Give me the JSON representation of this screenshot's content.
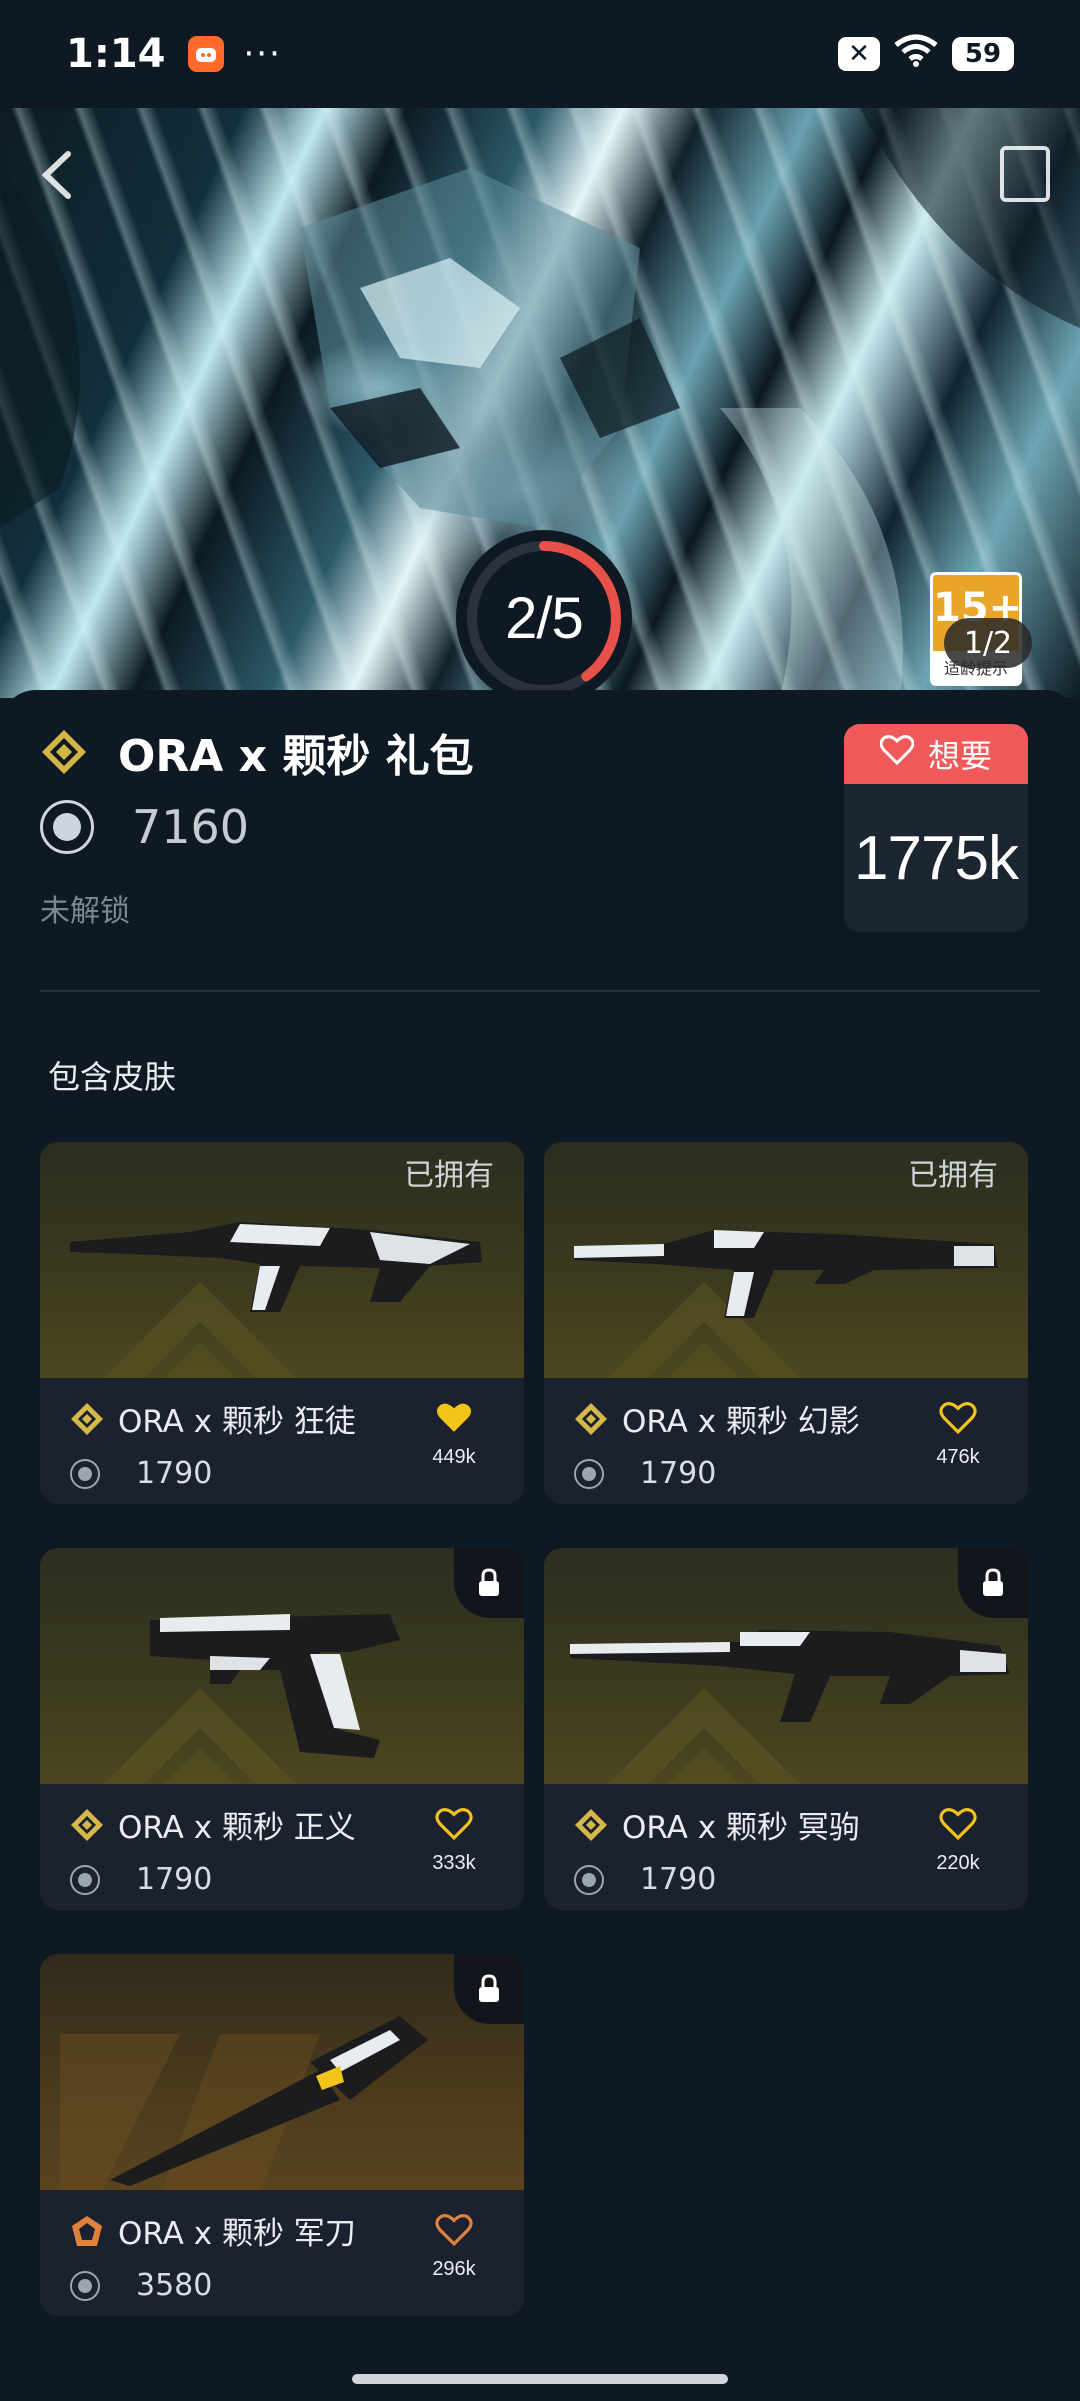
{
  "status_bar": {
    "time": "1:14",
    "dots": "···",
    "battery": "59",
    "x_badge": "✕"
  },
  "hero": {
    "age_rating": "15+",
    "age_text": "适龄提示",
    "page_indicator": "1/2",
    "progress_text": "2/5",
    "progress_fraction": 0.4
  },
  "bundle": {
    "title": "ORA x 颗秒 礼包",
    "price": "7160",
    "status": "未解锁",
    "want_label": "想要",
    "want_count": "1775k"
  },
  "section": {
    "title": "包含皮肤"
  },
  "skins": [
    {
      "name": "ORA x 颗秒 狂徒",
      "price": "1790",
      "likes": "449k",
      "tag": "已拥有",
      "liked": true,
      "tier_color": "#d4b84a"
    },
    {
      "name": "ORA x 颗秒 幻影",
      "price": "1790",
      "likes": "476k",
      "tag": "已拥有",
      "liked": false,
      "tier_color": "#d4b84a"
    },
    {
      "name": "ORA x 颗秒 正义",
      "price": "1790",
      "likes": "333k",
      "tag": "",
      "liked": false,
      "tier_color": "#d4b84a"
    },
    {
      "name": "ORA x 颗秒 冥驹",
      "price": "1790",
      "likes": "220k",
      "tag": "",
      "liked": false,
      "tier_color": "#d4b84a"
    },
    {
      "name": "ORA x 颗秒 军刀",
      "price": "3580",
      "likes": "296k",
      "tag": "",
      "liked": false,
      "tier_color": "#e0823c"
    }
  ],
  "colors": {
    "background": "#0f1923",
    "want_red": "#f05a5a",
    "gold": "#f0c419",
    "progress_red": "#e8504a"
  }
}
